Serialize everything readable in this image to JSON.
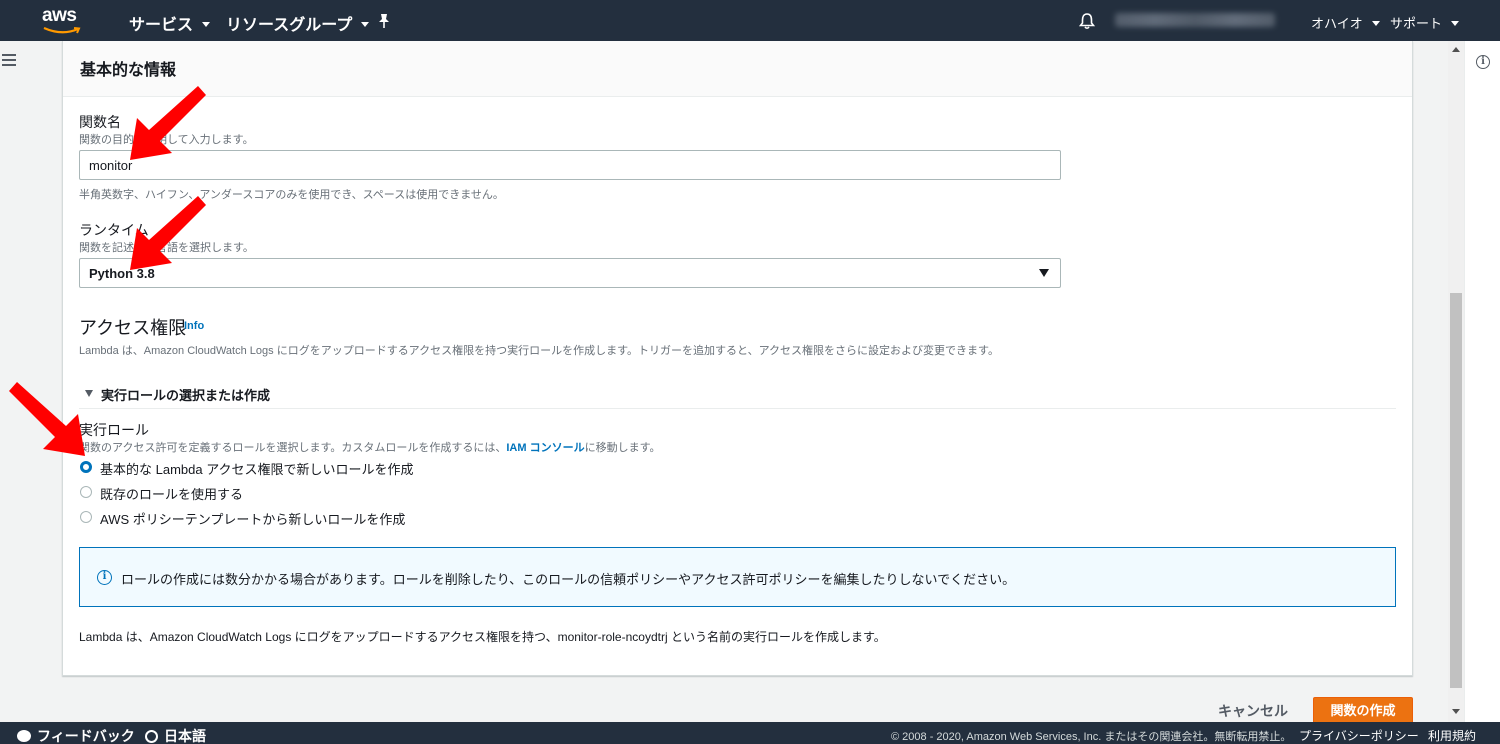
{
  "nav": {
    "logo": "aws",
    "services": "サービス",
    "resource_groups": "リソースグループ",
    "region": "オハイオ",
    "support": "サポート"
  },
  "panel": {
    "title": "基本的な情報"
  },
  "function_name": {
    "label": "関数名",
    "description": "関数の目的を説明して入力します。",
    "value": "monitor",
    "hint": "半角英数字、ハイフン、アンダースコアのみを使用でき、スペースは使用できません。"
  },
  "runtime": {
    "label": "ランタイム",
    "description": "関数を記述する言語を選択します。",
    "value": "Python 3.8"
  },
  "permissions": {
    "title": "アクセス権限",
    "info": "Info",
    "description": "Lambda は、Amazon CloudWatch Logs にログをアップロードするアクセス権限を持つ実行ロールを作成します。トリガーを追加すると、アクセス権限をさらに設定および変更できます。",
    "expander": "実行ロールの選択または作成",
    "role_label": "実行ロール",
    "role_desc_prefix": "関数のアクセス許可を定義するロールを選択します。カスタムロールを作成するには、",
    "role_desc_link": "IAM コンソール",
    "role_desc_suffix": "に移動します。",
    "options": [
      {
        "label": "基本的な Lambda アクセス権限で新しいロールを作成",
        "selected": true
      },
      {
        "label": "既存のロールを使用する",
        "selected": false
      },
      {
        "label": "AWS ポリシーテンプレートから新しいロールを作成",
        "selected": false
      }
    ],
    "alert": "ロールの作成には数分かかる場合があります。ロールを削除したり、このロールの信頼ポリシーやアクセス許可ポリシーを編集したりしないでください。",
    "note": "Lambda は、Amazon CloudWatch Logs にログをアップロードするアクセス権限を持つ、monitor-role-ncoydtrj という名前の実行ロールを作成します。"
  },
  "actions": {
    "cancel": "キャンセル",
    "create": "関数の作成"
  },
  "footer": {
    "feedback": "フィードバック",
    "language": "日本語",
    "copyright": "© 2008 - 2020, Amazon Web Services, Inc. またはその関連会社。無断転用禁止。",
    "privacy": "プライバシーポリシー",
    "terms": "利用規約"
  },
  "colors": {
    "nav_bg": "#232f3e",
    "accent_orange": "#ec7211",
    "link_blue": "#0073bb",
    "annotation_red": "#ff0000"
  }
}
